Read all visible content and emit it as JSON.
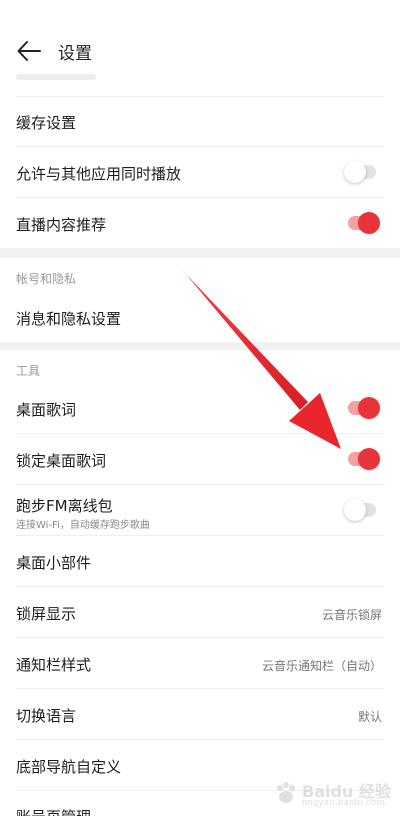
{
  "header": {
    "title": "设置",
    "back_icon": "arrow-left-icon"
  },
  "items": [
    {
      "label": "缓存设置"
    },
    {
      "label": "允许与其他应用同时播放",
      "toggle": "off"
    },
    {
      "label": "直播内容推荐",
      "toggle": "on"
    }
  ],
  "sections": {
    "account": {
      "title": "帐号和隐私",
      "items": [
        {
          "label": "消息和隐私设置"
        }
      ]
    },
    "tools": {
      "title": "工具",
      "items": [
        {
          "label": "桌面歌词",
          "toggle": "on"
        },
        {
          "label": "锁定桌面歌词",
          "toggle": "on"
        },
        {
          "label": "跑步FM离线包",
          "sublabel": "连接Wi-Fi，自动缓存跑步歌曲",
          "toggle": "off"
        },
        {
          "label": "桌面小部件"
        },
        {
          "label": "锁屏显示",
          "value": "云音乐锁屏"
        },
        {
          "label": "通知栏样式",
          "value": "云音乐通知栏（自动）"
        },
        {
          "label": "切换语言",
          "value": "默认"
        },
        {
          "label": "底部导航自定义"
        },
        {
          "label": "账号页管理"
        }
      ]
    }
  },
  "annotation": {
    "arrow_color": "#e8262b"
  },
  "watermark": {
    "text": "Baidu 经验",
    "sub": "jingyan.baidu.com"
  },
  "colors": {
    "accent": "#e8333a",
    "toggle_on_track": "#f6a0a0",
    "toggle_off_track": "#e3e3e3",
    "section_bg": "#f2f2f2"
  }
}
